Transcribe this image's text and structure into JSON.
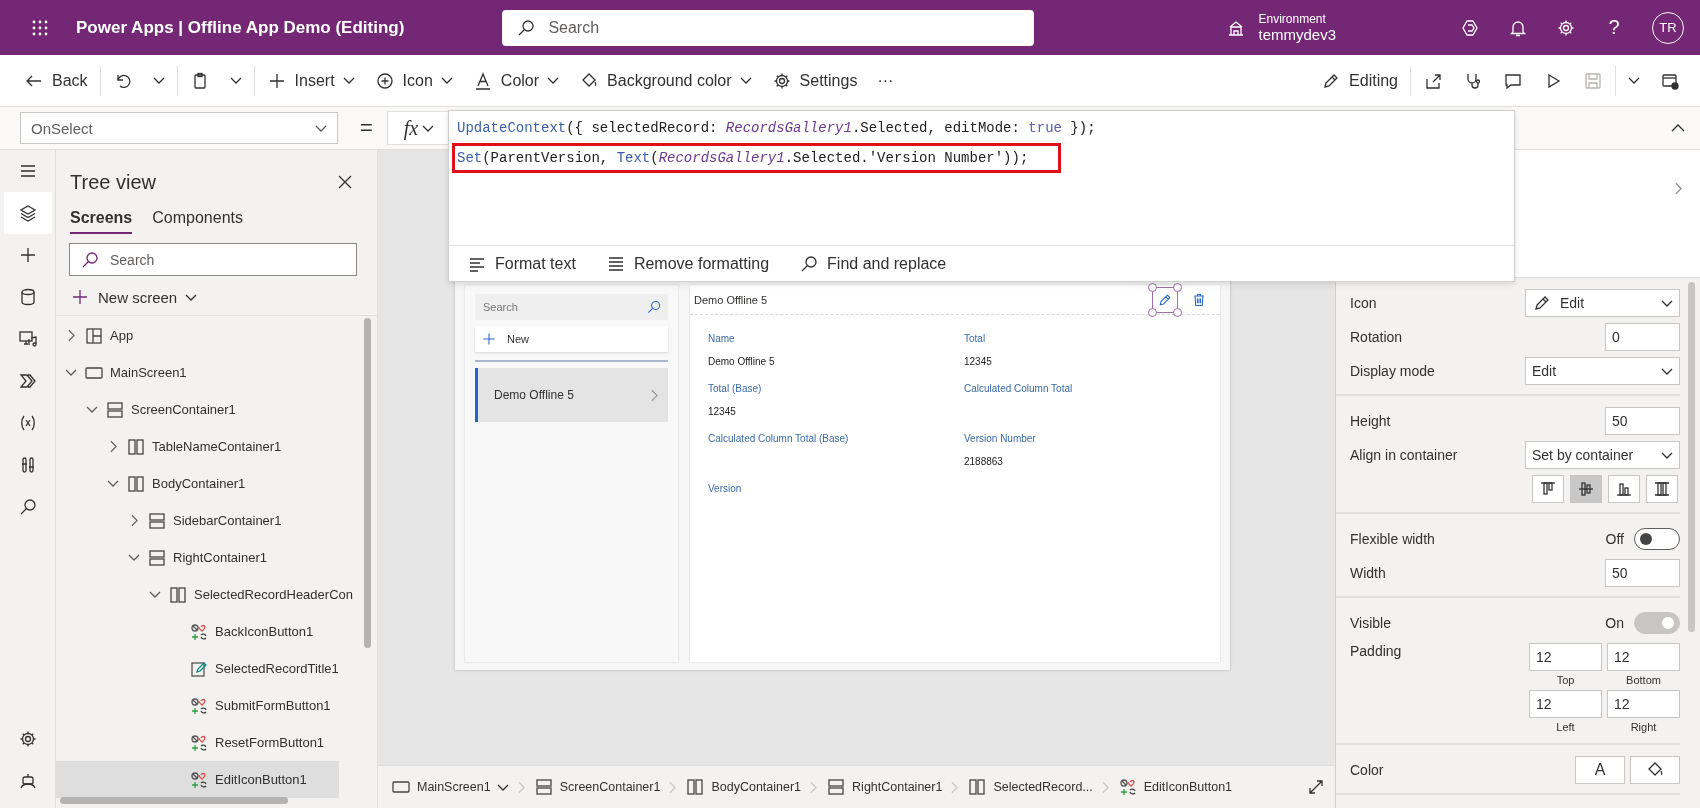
{
  "header": {
    "title": "Power Apps | Offline App Demo (Editing)",
    "search": {
      "placeholder": "Search"
    },
    "environment": {
      "label": "Environment",
      "name": "temmydev3"
    },
    "actions": [
      {
        "kind": "logo"
      },
      {
        "kind": "notifications"
      },
      {
        "kind": "settings"
      },
      {
        "kind": "help",
        "text": "?"
      }
    ],
    "avatar": "TR"
  },
  "toolbar": {
    "left": [
      {
        "kind": "back",
        "label": "Back",
        "menu": false
      },
      {
        "kind": "separator"
      },
      {
        "kind": "undo",
        "menu": false
      },
      {
        "kind": "caret",
        "menu": false
      },
      {
        "kind": "separator"
      },
      {
        "kind": "paste",
        "menu": false
      },
      {
        "kind": "caret",
        "menu": false
      },
      {
        "kind": "separator"
      },
      {
        "kind": "insert",
        "label": "Insert",
        "menu": true
      },
      {
        "kind": "icon",
        "label": "Icon",
        "menu": true
      },
      {
        "kind": "color",
        "label": "Color",
        "menu": true
      },
      {
        "kind": "background",
        "label": "Background color",
        "menu": true
      },
      {
        "kind": "settings",
        "label": "Settings",
        "menu": false
      },
      {
        "kind": "more",
        "label": "···",
        "menu": false
      }
    ],
    "right": [
      {
        "kind": "editing",
        "label": "Editing",
        "disabled": false
      },
      {
        "kind": "separator"
      },
      {
        "kind": "share",
        "disabled": false
      },
      {
        "kind": "checker",
        "disabled": false
      },
      {
        "kind": "comments",
        "disabled": false
      },
      {
        "kind": "preview",
        "disabled": false
      },
      {
        "kind": "save",
        "disabled": true
      },
      {
        "kind": "separator"
      },
      {
        "kind": "caret",
        "disabled": false
      },
      {
        "kind": "publish",
        "disabled": false
      }
    ]
  },
  "formula": {
    "property": "OnSelect",
    "equals": "=",
    "fx": "fx",
    "lines": [
      {
        "highlighted": false,
        "tokens": [
          {
            "kind": "function",
            "text": "UpdateContext"
          },
          {
            "kind": "plain",
            "text": "({ selectedRecord: "
          },
          {
            "kind": "identifier",
            "text": "RecordsGallery1"
          },
          {
            "kind": "plain",
            "text": ".Selected, editMode: "
          },
          {
            "kind": "keyword",
            "text": "true"
          },
          {
            "kind": "plain",
            "text": " });"
          }
        ]
      },
      {
        "highlighted": true,
        "tokens": [
          {
            "kind": "function",
            "text": "Set"
          },
          {
            "kind": "plain",
            "text": "(ParentVersion, "
          },
          {
            "kind": "function",
            "text": "Text"
          },
          {
            "kind": "plain",
            "text": "("
          },
          {
            "kind": "identifier",
            "text": "RecordsGallery1"
          },
          {
            "kind": "plain",
            "text": ".Selected.'Version Number'));"
          }
        ]
      }
    ],
    "tools": [
      {
        "kind": "format",
        "label": "Format text"
      },
      {
        "kind": "remove",
        "label": "Remove formatting"
      },
      {
        "kind": "find",
        "label": "Find and replace"
      }
    ]
  },
  "rail": {
    "top": [
      {
        "kind": "menu",
        "selected": false
      },
      {
        "kind": "tree",
        "selected": true
      },
      {
        "kind": "insert",
        "selected": false
      },
      {
        "kind": "data",
        "selected": false
      },
      {
        "kind": "media",
        "selected": false
      },
      {
        "kind": "flows",
        "selected": false
      },
      {
        "kind": "variables",
        "selected": false
      },
      {
        "kind": "tools",
        "selected": false
      },
      {
        "kind": "search",
        "selected": false
      }
    ],
    "bottom": [
      {
        "kind": "settings",
        "selected": false
      },
      {
        "kind": "bot",
        "selected": false
      }
    ]
  },
  "tree": {
    "title": "Tree view",
    "tabs": [
      {
        "label": "Screens",
        "selected": true
      },
      {
        "label": "Components",
        "selected": false
      }
    ],
    "search": {
      "placeholder": "Search"
    },
    "new_screen": "New screen",
    "nodes": [
      {
        "label": "App",
        "kind": "app",
        "expanded": false,
        "selected": false
      },
      {
        "label": "MainScreen1",
        "kind": "screen",
        "expanded": true,
        "selected": false,
        "children": [
          {
            "label": "ScreenContainer1",
            "kind": "stacked",
            "expanded": true,
            "selected": false,
            "children": [
              {
                "label": "TableNameContainer1",
                "kind": "columns",
                "expanded": false,
                "selected": false
              },
              {
                "label": "BodyContainer1",
                "kind": "columns",
                "expanded": true,
                "selected": false,
                "children": [
                  {
                    "label": "SidebarContainer1",
                    "kind": "stacked",
                    "expanded": false,
                    "selected": false
                  },
                  {
                    "label": "RightContainer1",
                    "kind": "stacked",
                    "expanded": true,
                    "selected": false,
                    "children": [
                      {
                        "label": "SelectedRecordHeaderCon",
                        "kind": "columns",
                        "expanded": true,
                        "selected": false,
                        "children": [
                          {
                            "label": "BackIconButton1",
                            "kind": "control",
                            "selected": false
                          },
                          {
                            "label": "SelectedRecordTitle1",
                            "kind": "text",
                            "selected": false
                          },
                          {
                            "label": "SubmitFormButton1",
                            "kind": "control",
                            "selected": false
                          },
                          {
                            "label": "ResetFormButton1",
                            "kind": "control",
                            "selected": false
                          },
                          {
                            "label": "EditIconButton1",
                            "kind": "control",
                            "selected": true
                          }
                        ]
                      }
                    ]
                  }
                ]
              }
            ]
          }
        ]
      }
    ]
  },
  "canvas": {
    "search": {
      "placeholder": "Search"
    },
    "new_label": "New",
    "gallery": [
      {
        "title": "Demo Offline 5",
        "selected": true
      }
    ],
    "record": {
      "title": "Demo Offline 5",
      "actions": [
        {
          "kind": "edit",
          "selected": true
        },
        {
          "kind": "delete",
          "selected": false
        }
      ],
      "fields": [
        {
          "label": "Name",
          "value": "Demo Offline 5"
        },
        {
          "label": "Total",
          "value": "12345"
        },
        {
          "label": "Total (Base)",
          "value": "12345"
        },
        {
          "label": "Calculated Column Total"
        },
        {
          "label": "Calculated Column Total (Base)"
        },
        {
          "label": "Version Number",
          "value": "2188863"
        },
        {
          "label": "Version"
        }
      ]
    }
  },
  "breadcrumb": [
    {
      "kind": "screen",
      "label": "MainScreen1",
      "menu": true
    },
    {
      "kind": "stacked",
      "label": "ScreenContainer1",
      "menu": false
    },
    {
      "kind": "columns",
      "label": "BodyContainer1",
      "menu": false
    },
    {
      "kind": "stacked",
      "label": "RightContainer1",
      "menu": false
    },
    {
      "kind": "columns",
      "label": "SelectedRecord...",
      "menu": false
    },
    {
      "kind": "control",
      "label": "EditIconButton1",
      "menu": false
    }
  ],
  "properties": {
    "groups": [
      [
        {
          "kind": "icon-dropdown",
          "label": "Icon",
          "value": "Edit"
        },
        {
          "kind": "number",
          "label": "Rotation",
          "value": "0"
        },
        {
          "kind": "dropdown",
          "label": "Display mode",
          "value": "Edit"
        }
      ],
      [
        {
          "kind": "number",
          "label": "Height",
          "value": "50"
        },
        {
          "kind": "dropdown",
          "label": "Align in container",
          "value": "Set by container"
        },
        {
          "kind": "align-buttons",
          "buttons": [
            {
              "selected": false
            },
            {
              "selected": true
            },
            {
              "selected": false
            },
            {
              "selected": false
            }
          ]
        }
      ],
      [
        {
          "kind": "toggle",
          "label": "Flexible width",
          "state": "Off",
          "on": false,
          "disabled": false
        },
        {
          "kind": "number",
          "label": "Width",
          "value": "50"
        }
      ],
      [
        {
          "kind": "toggle",
          "label": "Visible",
          "state": "On",
          "on": true,
          "disabled": true
        },
        {
          "kind": "padding",
          "label": "Padding",
          "fields": [
            {
              "value": "12",
              "caption": "Top"
            },
            {
              "value": "12",
              "caption": "Bottom"
            },
            {
              "value": "12",
              "caption": "Left"
            },
            {
              "value": "12",
              "caption": "Right"
            }
          ]
        }
      ],
      [
        {
          "kind": "color",
          "label": "Color",
          "swatch": "A"
        }
      ]
    ]
  }
}
